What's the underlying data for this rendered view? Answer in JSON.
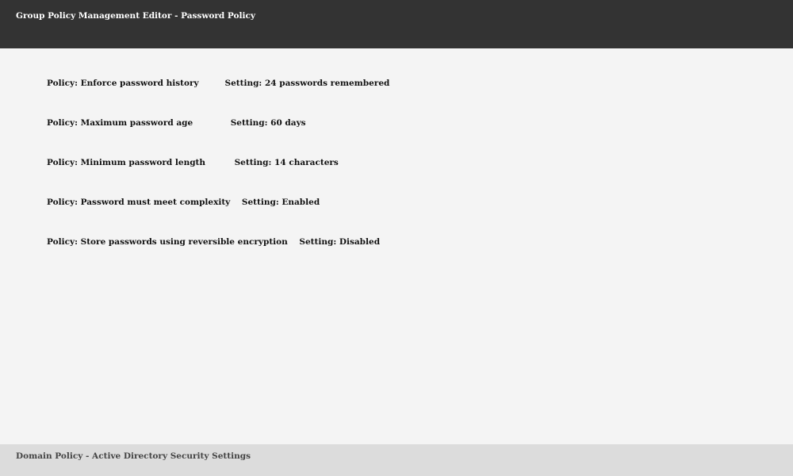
{
  "window": {
    "title": "Group Policy Management Editor - Password Policy"
  },
  "policies": [
    {
      "text": "Policy: Enforce password history         Setting: 24 passwords remembered"
    },
    {
      "text": "Policy: Maximum password age             Setting: 60 days"
    },
    {
      "text": "Policy: Minimum password length          Setting: 14 characters"
    },
    {
      "text": "Policy: Password must meet complexity    Setting: Enabled"
    },
    {
      "text": "Policy: Store passwords using reversible encryption    Setting: Disabled"
    }
  ],
  "status_bar": {
    "text": "Domain Policy - Active Directory Security Settings"
  },
  "colors": {
    "title_bar": "#333333",
    "background": "#f4f4f4",
    "status_bar": "#dcdcdc"
  }
}
